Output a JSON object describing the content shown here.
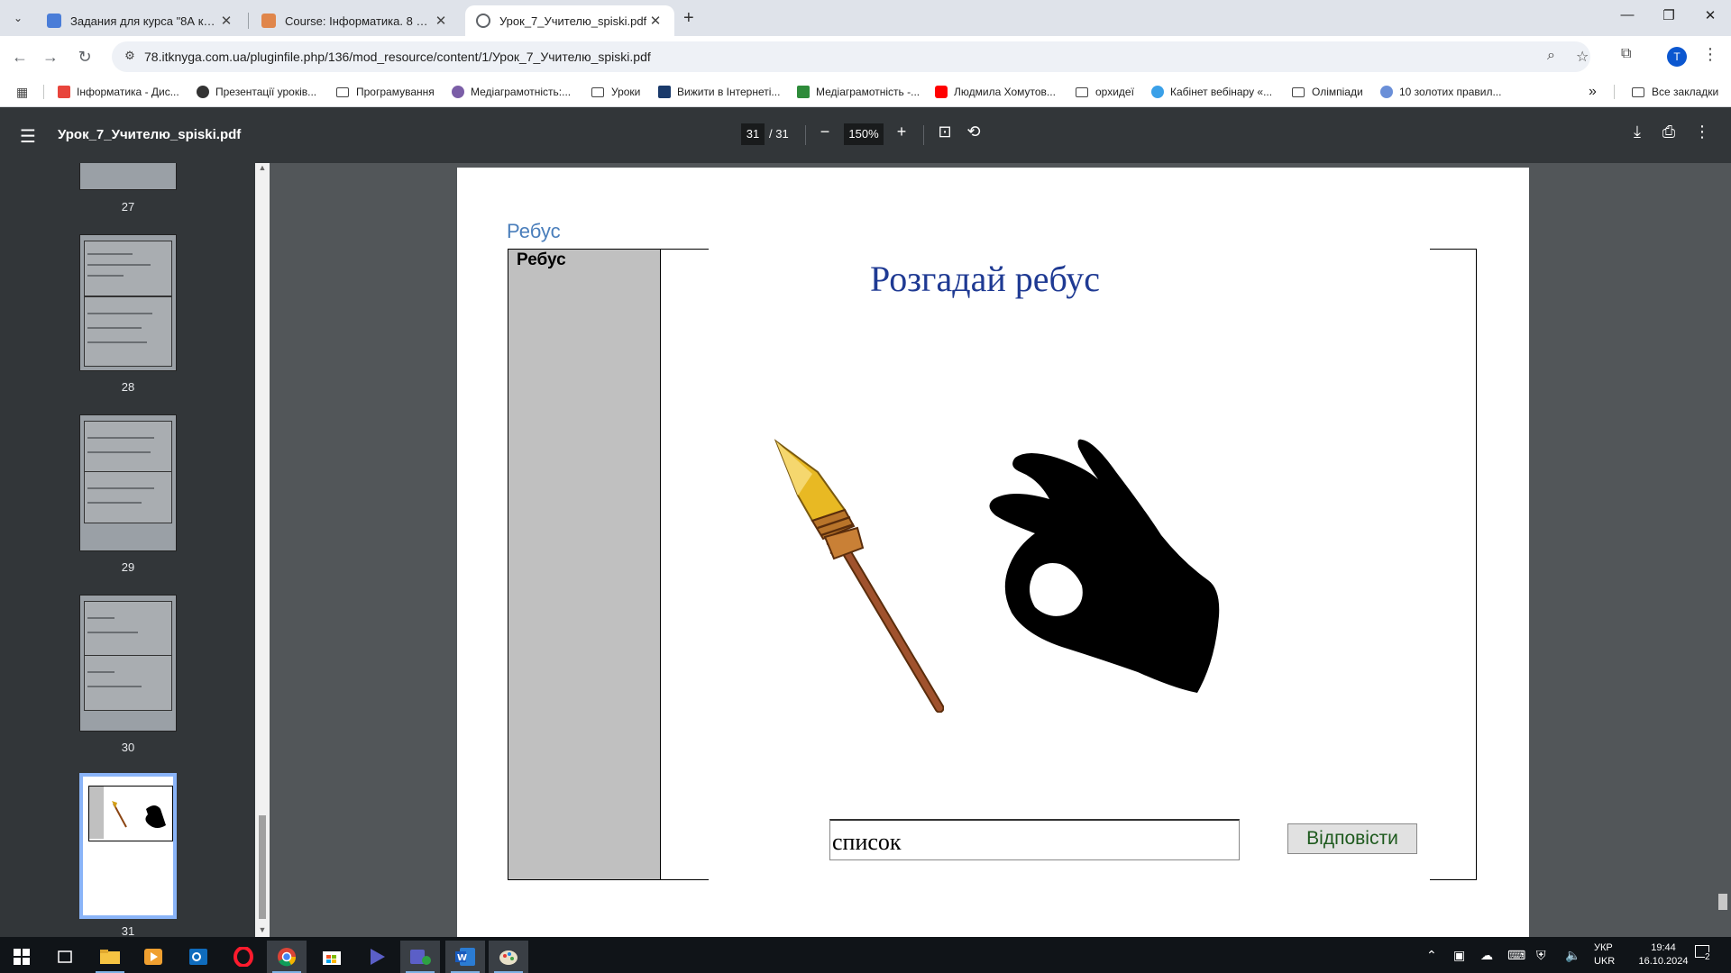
{
  "browser": {
    "tabs": [
      {
        "title": "Задания для курса \"8А клас Інф",
        "color": "#4a7dd8"
      },
      {
        "title": "Course: Інформатика. 8 клас",
        "color": "#e0864b"
      },
      {
        "title": "Урок_7_Учителю_spiski.pdf",
        "color": "#5f6368"
      }
    ],
    "new_tab": "+",
    "url": "78.itknyga.com.ua/pluginfile.php/136/mod_resource/content/1/Урок_7_Учителю_spiski.pdf",
    "avatar_letter": "T",
    "bookmarks": [
      {
        "label": "Інформатика - Дис...",
        "kind": "icon",
        "color": "#e8453c"
      },
      {
        "label": "Презентації уроків...",
        "kind": "icon",
        "color": "#333333"
      },
      {
        "label": "Програмування",
        "kind": "folder"
      },
      {
        "label": "Медіаграмотність:...",
        "kind": "icon",
        "color": "#7b5ea7"
      },
      {
        "label": "Уроки",
        "kind": "folder"
      },
      {
        "label": "Вижити в Інтернеті...",
        "kind": "icon",
        "color": "#1a3a6b"
      },
      {
        "label": "Медіаграмотність -...",
        "kind": "icon",
        "color": "#2e8b3a"
      },
      {
        "label": "Людмила Хомутов...",
        "kind": "icon",
        "color": "#ff0000"
      },
      {
        "label": "орхидеї",
        "kind": "folder"
      },
      {
        "label": "Кабінет вебінару «...",
        "kind": "icon",
        "color": "#3aa0e8"
      },
      {
        "label": "Олімпіади",
        "kind": "folder"
      },
      {
        "label": "10 золотих правил...",
        "kind": "icon",
        "color": "#6a8fd8"
      }
    ],
    "all_bookmarks": "Все закладки",
    "more_bookmarks": "»"
  },
  "pdf": {
    "filename": "Урок_7_Учителю_spiski.pdf",
    "current_page": "31",
    "total_pages": "/ 31",
    "zoom": "150%",
    "thumbnails": [
      {
        "label": "27"
      },
      {
        "label": "28"
      },
      {
        "label": "29"
      },
      {
        "label": "30"
      },
      {
        "label": "31"
      }
    ]
  },
  "slide": {
    "heading": "Ребус",
    "left_label": "Ребус",
    "title": "Розгадай ребус",
    "answer_value": "список",
    "answer_button": "Відповісти",
    "pictures": [
      "spear",
      "ok-hand"
    ]
  },
  "taskbar": {
    "lang": "УКР",
    "lang2": "UKR",
    "time": "19:44",
    "date": "16.10.2024",
    "notif_count": "2"
  }
}
